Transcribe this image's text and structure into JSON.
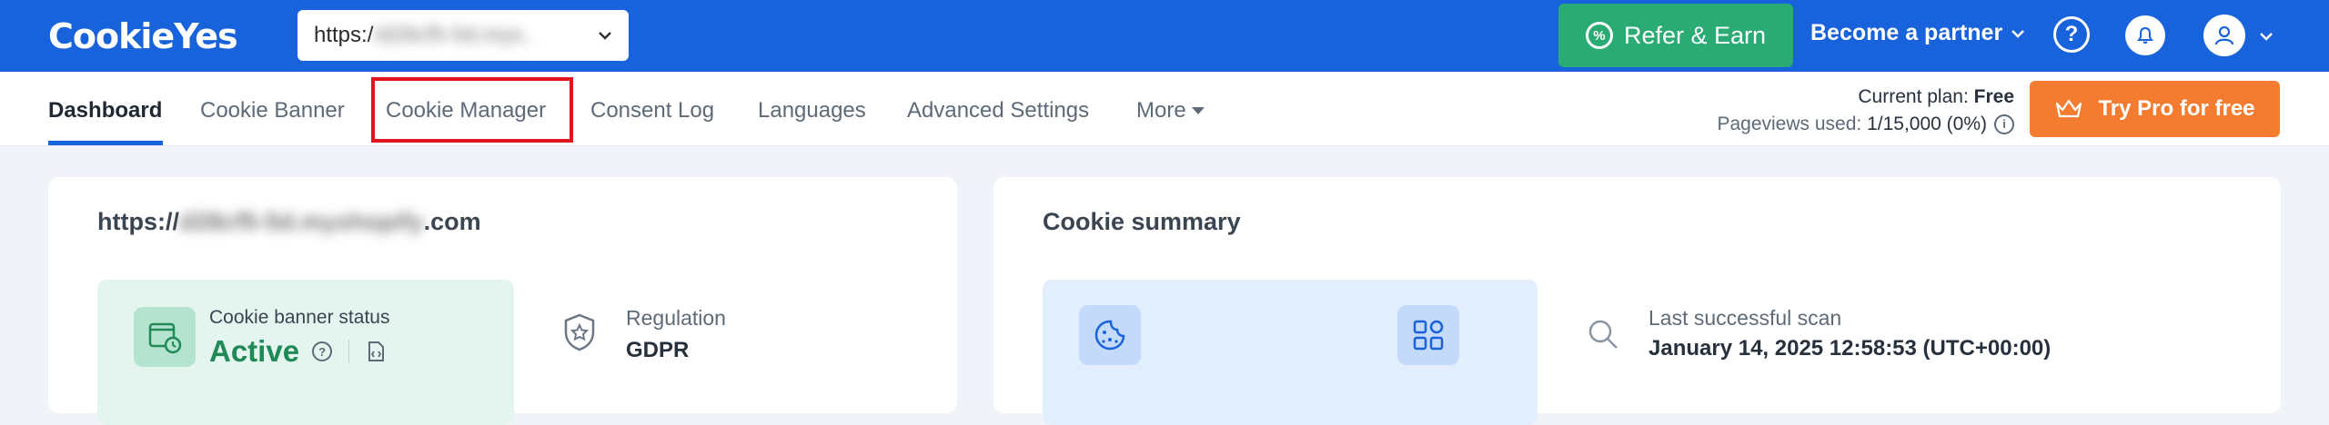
{
  "header": {
    "logo": "CookieYes",
    "site_prefix": "https:/",
    "site_blurred": "/d28cf5-5d.mys..",
    "refer_label": "Refer & Earn",
    "partner_label": "Become a partner",
    "help_glyph": "?"
  },
  "nav": {
    "items": [
      "Dashboard",
      "Cookie Banner",
      "Cookie Manager",
      "Consent Log",
      "Languages",
      "Advanced Settings",
      "More"
    ],
    "active": "Dashboard"
  },
  "plan": {
    "current_plan_label": "Current plan:",
    "current_plan_value": "Free",
    "pageviews_label": "Pageviews used:",
    "pageviews_value": "1/15,000 (0%)",
    "try_pro_label": "Try Pro for free"
  },
  "site_card": {
    "url_prefix": "https://",
    "url_blurred": "d28cf5-5d.myshopify",
    "url_suffix": ".com",
    "status_label": "Cookie banner status",
    "status_value": "Active",
    "regulation_label": "Regulation",
    "regulation_value": "GDPR"
  },
  "summary_card": {
    "title": "Cookie summary",
    "scan_label": "Last successful scan",
    "scan_value": "January 14, 2025 12:58:53 (UTC+00:00)"
  },
  "colors": {
    "brand_blue": "#1863dc",
    "refer_green": "#2aab74",
    "try_pro_orange": "#f47c30",
    "active_green": "#1f8a56",
    "highlight_red": "#e0161e"
  }
}
